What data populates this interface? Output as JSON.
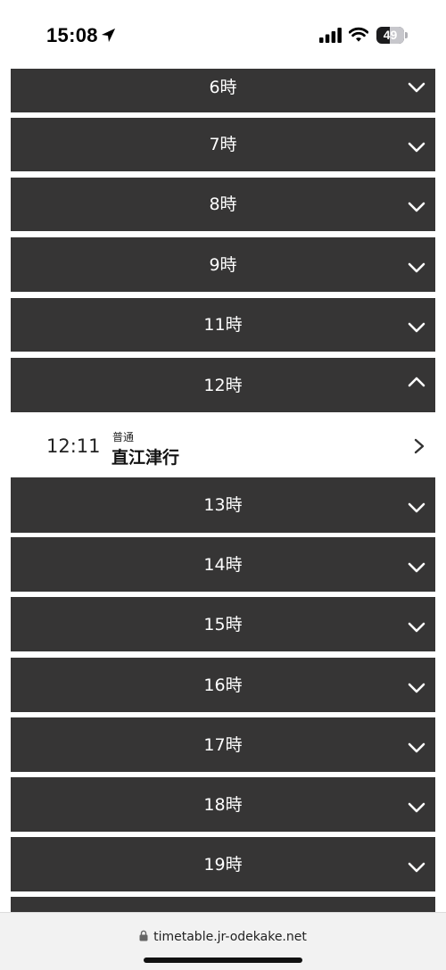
{
  "status_bar": {
    "time": "15:08",
    "battery_level": 49,
    "battery_text": "49",
    "icons": [
      "location-arrow-icon",
      "cellular-signal-icon",
      "wifi-icon",
      "battery-icon"
    ]
  },
  "hours": [
    {
      "label": "6時",
      "expanded": false
    },
    {
      "label": "7時",
      "expanded": false
    },
    {
      "label": "8時",
      "expanded": false
    },
    {
      "label": "9時",
      "expanded": false
    },
    {
      "label": "11時",
      "expanded": false
    },
    {
      "label": "12時",
      "expanded": true
    },
    {
      "label": "13時",
      "expanded": false
    },
    {
      "label": "14時",
      "expanded": false
    },
    {
      "label": "15時",
      "expanded": false
    },
    {
      "label": "16時",
      "expanded": false
    },
    {
      "label": "17時",
      "expanded": false
    },
    {
      "label": "18時",
      "expanded": false
    },
    {
      "label": "19時",
      "expanded": false
    }
  ],
  "departure": {
    "time": "12:11",
    "type": "普通",
    "destination": "直江津行"
  },
  "browser": {
    "url": "timetable.jr-odekake.net"
  },
  "colors": {
    "row_background": "#363535",
    "row_text": "#ffffff",
    "page_background": "#ffffff"
  }
}
